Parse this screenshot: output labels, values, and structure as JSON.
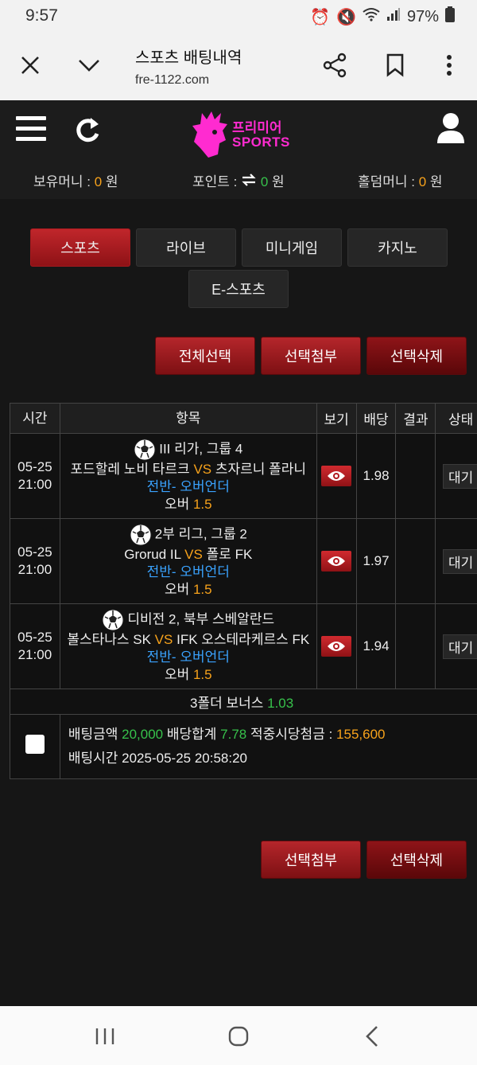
{
  "status": {
    "time": "9:57",
    "battery": "97%"
  },
  "browser": {
    "title": "스포츠 배팅내역",
    "url": "fre-1122.com"
  },
  "logo": {
    "kr": "프리미어",
    "en": "SPORTS"
  },
  "balance": {
    "money_label": "보유머니 : ",
    "money_value": "0",
    "money_unit": " 원",
    "point_label": "포인트 : ",
    "point_value": "0",
    "point_unit": " 원",
    "holdem_label": "홀덤머니 : ",
    "holdem_value": "0",
    "holdem_unit": " 원"
  },
  "tabs": [
    "스포츠",
    "라이브",
    "미니게임",
    "카지노",
    "E-스포츠"
  ],
  "top_actions": [
    "전체선택",
    "선택첨부",
    "선택삭제"
  ],
  "table": {
    "headers": [
      "시간",
      "항목",
      "보기",
      "배당",
      "결과",
      "상태"
    ],
    "rows": [
      {
        "date": "05-25",
        "time": "21:00",
        "league": "III 리가, 그룹 4",
        "home": "포드할레 노비 타르크",
        "vs": "VS",
        "away": "츠자르니 폴라니",
        "market": "전반- 오버언더",
        "pick": "오버",
        "line": "1.5",
        "odds": "1.98",
        "state": "대기"
      },
      {
        "date": "05-25",
        "time": "21:00",
        "league": "2부 리그, 그룹 2",
        "home": "Grorud IL",
        "vs": "VS",
        "away": "폴로 FK",
        "market": "전반- 오버언더",
        "pick": "오버",
        "line": "1.5",
        "odds": "1.97",
        "state": "대기"
      },
      {
        "date": "05-25",
        "time": "21:00",
        "league": "디비전 2, 북부 스베알란드",
        "home": "볼스타나스 SK",
        "vs": "VS",
        "away": "IFK 오스테라케르스 FK",
        "market": "전반- 오버언더",
        "pick": "오버",
        "line": "1.5",
        "odds": "1.94",
        "state": "대기"
      }
    ],
    "bonus_label": "3폴더 보너스",
    "bonus_value": "1.03",
    "summary": {
      "amount_label": "배팅금액",
      "amount_value": "20,000",
      "total_label": "배당합계",
      "total_value": "7.78",
      "win_label": "적중시당첨금 :",
      "win_value": "155,600",
      "time_label": "배팅시간",
      "time_value": "2025-05-25 20:58:20"
    }
  },
  "bottom_actions": [
    "선택첨부",
    "선택삭제"
  ]
}
